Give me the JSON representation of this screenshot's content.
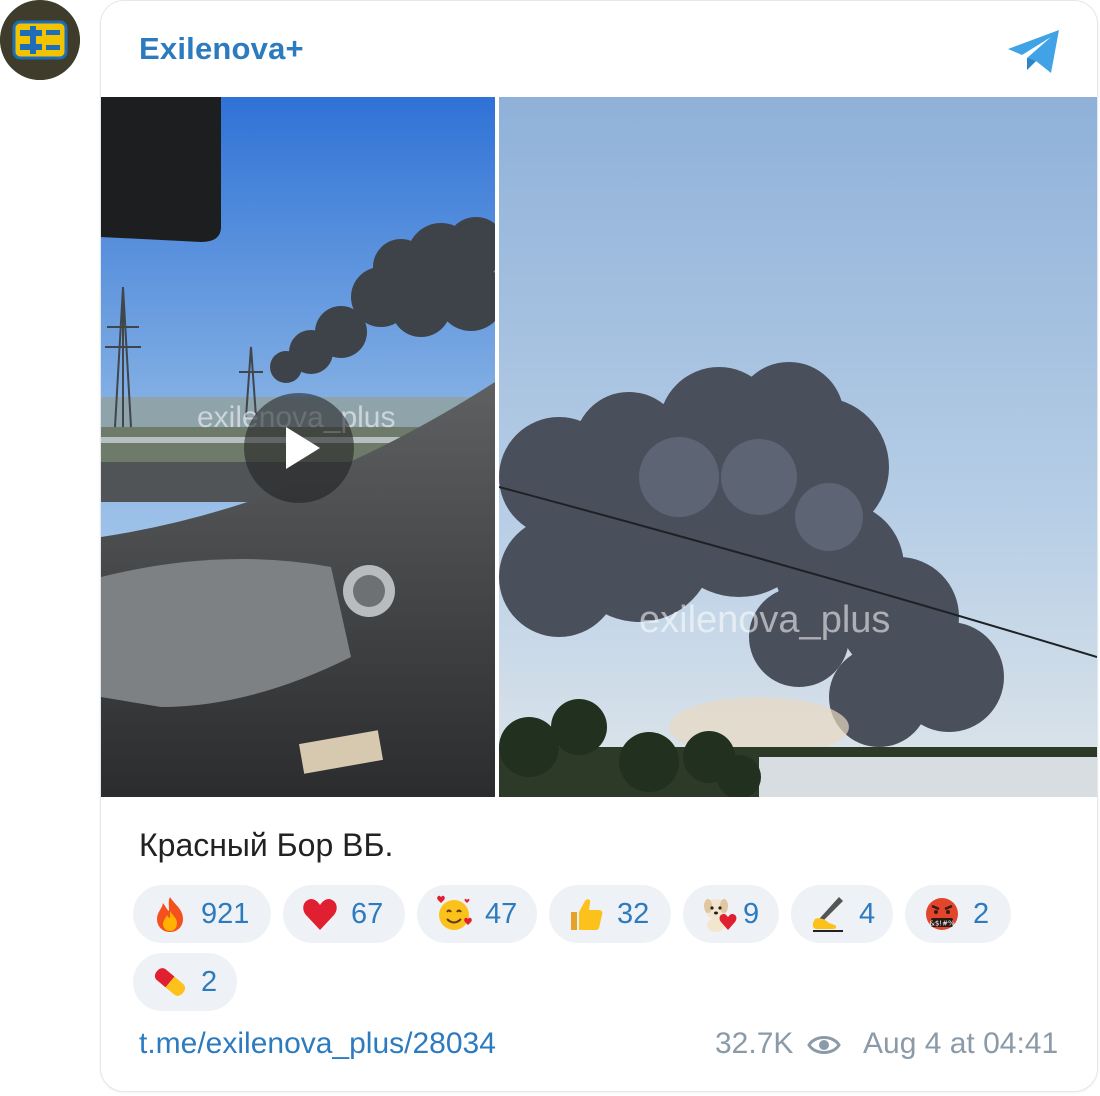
{
  "channel": {
    "name": "Exilenova+",
    "avatar_icon": "exilenova-logo-icon",
    "platform_icon": "telegram-icon"
  },
  "media": {
    "left_photo": {
      "kind": "video",
      "watermark": "exilenova_plus",
      "play_icon": "play-icon"
    },
    "right_photo": {
      "kind": "photo",
      "watermark": "exilenova_plus"
    }
  },
  "post": {
    "caption": "Красный Бор ВБ."
  },
  "reactions": [
    {
      "emoji": "fire-emoji",
      "count": "921"
    },
    {
      "emoji": "red-heart-emoji",
      "count": "67"
    },
    {
      "emoji": "smiling-face-with-hearts-emoji",
      "count": "47"
    },
    {
      "emoji": "thumbs-up-emoji",
      "count": "32"
    },
    {
      "emoji": "dog-with-heart-sticker",
      "count": "9"
    },
    {
      "emoji": "writing-hand-emoji",
      "count": "4"
    },
    {
      "emoji": "face-with-symbols-on-mouth-emoji",
      "count": "2"
    },
    {
      "emoji": "pill-emoji",
      "count": "2"
    }
  ],
  "footer": {
    "link": "t.me/exilenova_plus/28034",
    "views": "32.7K",
    "views_icon": "eye-icon",
    "timestamp": "Aug 4 at 04:41"
  },
  "colors": {
    "accent": "#2d7bbf",
    "reaction_bg": "#eef2f6",
    "muted": "#8a9aa8"
  }
}
